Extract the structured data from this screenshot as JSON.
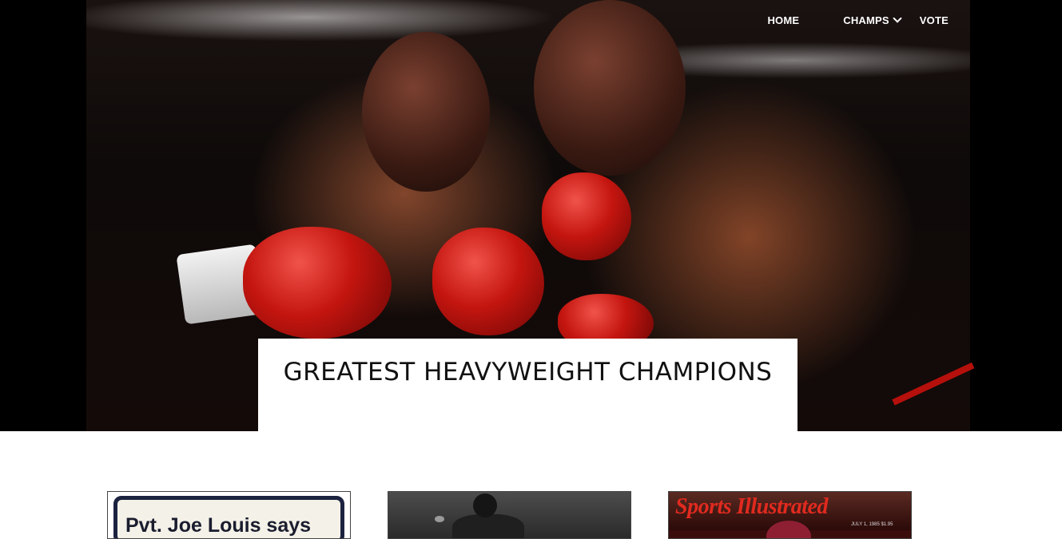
{
  "nav": {
    "items": [
      {
        "label": "HOME"
      },
      {
        "label": "CHAMPS",
        "has_dropdown": true
      },
      {
        "label": "VOTE"
      }
    ]
  },
  "hero": {
    "title": "GREATEST HEAVYWEIGHT CHAMPIONS",
    "image_icon": "boxing-match-photo"
  },
  "cards": [
    {
      "caption_visible_text": "Pvt. Joe Louis says"
    },
    {
      "icon": "boxer-photo"
    },
    {
      "masthead": "Sports Illustrated",
      "issue_line": "JULY 1, 1985 $1.95"
    }
  ],
  "colors": {
    "hero_background": "#000000",
    "title_box": "#ffffff",
    "nav_text": "#ffffff",
    "glove_red": "#c4150f",
    "masthead_red": "#e12a1f"
  }
}
